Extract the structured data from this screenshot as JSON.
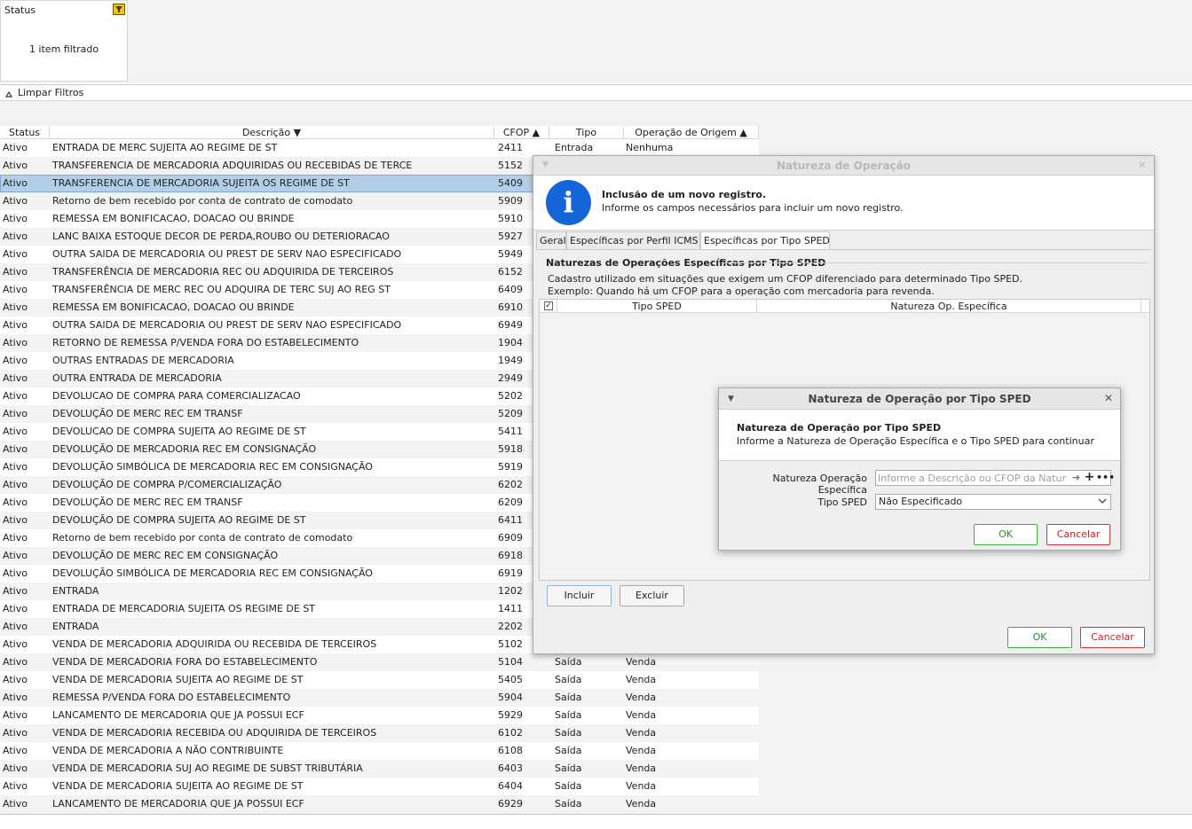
{
  "filter": {
    "card_title": "Status",
    "card_message": "1 item filtrado",
    "clear_label": "Limpar Filtros"
  },
  "grid": {
    "columns": {
      "status": "Status",
      "descricao": "Descrição ▼",
      "cfop": "CFOP ▲",
      "tipo": "Tipo",
      "origem": "Operação de Origem ▲"
    },
    "rows": [
      {
        "status": "Ativo",
        "desc": "ENTRADA DE MERC SUJEITA AO REGIME DE ST",
        "cfop": "2411",
        "tipo": "Entrada",
        "origem": "Nenhuma"
      },
      {
        "status": "Ativo",
        "desc": "TRANSFERENCIA DE MERCADORIA ADQUIRIDAS OU RECEBIDAS DE TERCE",
        "cfop": "5152",
        "tipo": "",
        "origem": ""
      },
      {
        "status": "Ativo",
        "desc": "TRANSFERENCIA DE MERCADORIA SUJEITA OS REGIME DE ST",
        "cfop": "5409",
        "tipo": "",
        "origem": ""
      },
      {
        "status": "Ativo",
        "desc": "Retorno de bem recebido por conta de contrato de comodato",
        "cfop": "5909",
        "tipo": "",
        "origem": ""
      },
      {
        "status": "Ativo",
        "desc": "REMESSA EM BONIFICACAO, DOACAO OU BRINDE",
        "cfop": "5910",
        "tipo": "",
        "origem": ""
      },
      {
        "status": "Ativo",
        "desc": "LANC BAIXA ESTOQUE DECOR DE PERDA,ROUBO OU DETERIORACAO",
        "cfop": "5927",
        "tipo": "",
        "origem": ""
      },
      {
        "status": "Ativo",
        "desc": "OUTRA SAIDA DE MERCADORIA OU PREST DE SERV NAO ESPECIFICADO",
        "cfop": "5949",
        "tipo": "",
        "origem": ""
      },
      {
        "status": "Ativo",
        "desc": "TRANSFERÊNCIA DE MERCADORIA REC OU ADQUIRIDA DE TERCEIROS",
        "cfop": "6152",
        "tipo": "",
        "origem": ""
      },
      {
        "status": "Ativo",
        "desc": "TRANSFERÊNCIA DE MERC REC OU ADQUIRA DE TERC SUJ AO REG ST",
        "cfop": "6409",
        "tipo": "",
        "origem": ""
      },
      {
        "status": "Ativo",
        "desc": "REMESSA EM BONIFICACAO, DOACAO OU BRINDE",
        "cfop": "6910",
        "tipo": "",
        "origem": ""
      },
      {
        "status": "Ativo",
        "desc": "OUTRA SAIDA DE MERCADORIA OU PREST DE SERV NAO ESPECIFICADO",
        "cfop": "6949",
        "tipo": "",
        "origem": ""
      },
      {
        "status": "Ativo",
        "desc": "RETORNO DE REMESSA P/VENDA FORA DO ESTABELECIMENTO",
        "cfop": "1904",
        "tipo": "",
        "origem": ""
      },
      {
        "status": "Ativo",
        "desc": "OUTRAS ENTRADAS DE MERCADORIA",
        "cfop": "1949",
        "tipo": "",
        "origem": ""
      },
      {
        "status": "Ativo",
        "desc": "OUTRA ENTRADA DE MERCADORIA",
        "cfop": "2949",
        "tipo": "",
        "origem": ""
      },
      {
        "status": "Ativo",
        "desc": "DEVOLUCAO DE COMPRA PARA COMERCIALIZACAO",
        "cfop": "5202",
        "tipo": "",
        "origem": ""
      },
      {
        "status": "Ativo",
        "desc": "DEVOLUÇÃO DE MERC REC EM TRANSF",
        "cfop": "5209",
        "tipo": "",
        "origem": ""
      },
      {
        "status": "Ativo",
        "desc": "DEVOLUCAO DE COMPRA SUJEITA AO REGIME DE ST",
        "cfop": "5411",
        "tipo": "",
        "origem": ""
      },
      {
        "status": "Ativo",
        "desc": "DEVOLUÇÃO DE MERCADORIA REC EM CONSIGNAÇÃO",
        "cfop": "5918",
        "tipo": "",
        "origem": ""
      },
      {
        "status": "Ativo",
        "desc": "DEVOLUÇÃO SIMBÓLICA DE MERCADORIA REC EM CONSIGNAÇÃO",
        "cfop": "5919",
        "tipo": "",
        "origem": ""
      },
      {
        "status": "Ativo",
        "desc": "DEVOLUÇÃO DE COMPRA P/COMERCIALIZAÇÃO",
        "cfop": "6202",
        "tipo": "",
        "origem": ""
      },
      {
        "status": "Ativo",
        "desc": "DEVOLUÇÃO DE MERC REC EM TRANSF",
        "cfop": "6209",
        "tipo": "",
        "origem": ""
      },
      {
        "status": "Ativo",
        "desc": "DEVOLUÇÃO DE COMPRA SUJEITA AO REGIME DE ST",
        "cfop": "6411",
        "tipo": "",
        "origem": ""
      },
      {
        "status": "Ativo",
        "desc": "Retorno de bem recebido por conta de contrato de comodato",
        "cfop": "6909",
        "tipo": "",
        "origem": ""
      },
      {
        "status": "Ativo",
        "desc": "DEVOLUÇÃO DE MERC REC EM CONSIGNAÇÃO",
        "cfop": "6918",
        "tipo": "",
        "origem": ""
      },
      {
        "status": "Ativo",
        "desc": "DEVOLUÇÃO SIMBÓLICA DE MERCADORIA REC EM CONSIGNAÇÃO",
        "cfop": "6919",
        "tipo": "",
        "origem": ""
      },
      {
        "status": "Ativo",
        "desc": "ENTRADA",
        "cfop": "1202",
        "tipo": "",
        "origem": ""
      },
      {
        "status": "Ativo",
        "desc": "ENTRADA DE MERCADORIA SUJEITA OS REGIME DE ST",
        "cfop": "1411",
        "tipo": "",
        "origem": ""
      },
      {
        "status": "Ativo",
        "desc": "ENTRADA",
        "cfop": "2202",
        "tipo": "",
        "origem": ""
      },
      {
        "status": "Ativo",
        "desc": "VENDA DE MERCADORIA ADQUIRIDA OU RECEBIDA DE TERCEIROS",
        "cfop": "5102",
        "tipo": "",
        "origem": ""
      },
      {
        "status": "Ativo",
        "desc": "VENDA DE MERCADORIA FORA DO ESTABELECIMENTO",
        "cfop": "5104",
        "tipo": "Saída",
        "origem": "Venda"
      },
      {
        "status": "Ativo",
        "desc": "VENDA DE MERCADORIA SUJEITA AO REGIME DE ST",
        "cfop": "5405",
        "tipo": "Saída",
        "origem": "Venda"
      },
      {
        "status": "Ativo",
        "desc": "REMESSA P/VENDA FORA DO ESTABELECIMENTO",
        "cfop": "5904",
        "tipo": "Saída",
        "origem": "Venda"
      },
      {
        "status": "Ativo",
        "desc": "LANCAMENTO DE MERCADORIA QUE JA POSSUI ECF",
        "cfop": "5929",
        "tipo": "Saída",
        "origem": "Venda"
      },
      {
        "status": "Ativo",
        "desc": "VENDA DE MERCADORIA RECEBIDA OU ADQUIRIDA DE TERCEIROS",
        "cfop": "6102",
        "tipo": "Saída",
        "origem": "Venda"
      },
      {
        "status": "Ativo",
        "desc": "VENDA DE MERCADORIA A NÃO CONTRIBUINTE",
        "cfop": "6108",
        "tipo": "Saída",
        "origem": "Venda"
      },
      {
        "status": "Ativo",
        "desc": "VENDA DE MERCADORIA SUJ AO REGIME DE SUBST TRIBUTÁRIA",
        "cfop": "6403",
        "tipo": "Saída",
        "origem": "Venda"
      },
      {
        "status": "Ativo",
        "desc": "VENDA DE MERCADORIA SUJEITA AO REGIME DE ST",
        "cfop": "6404",
        "tipo": "Saída",
        "origem": "Venda"
      },
      {
        "status": "Ativo",
        "desc": "LANCAMENTO DE MERCADORIA QUE JA POSSUI ECF",
        "cfop": "6929",
        "tipo": "Saída",
        "origem": "Venda"
      }
    ],
    "selected_index": 2
  },
  "dialog": {
    "title": "Natureza de Operação",
    "header_title": "Inclusão de um novo registro.",
    "header_subtitle": "Informe os campos necessários para incluir um novo registro.",
    "tabs": [
      "Geral",
      "Específicas por Perfil ICMS",
      "Específicas por Tipo SPED"
    ],
    "active_tab": 2,
    "section_title": "Naturezas de Operações Específicas por Tipo SPED",
    "section_desc1": "Cadastro utilizado em situações que exigem um CFOP diferenciado para determinado Tipo SPED.",
    "section_desc2": "Exemplo: Quando há um CFOP para a operação com mercadoria para revenda.",
    "table_columns": {
      "tipo": "Tipo SPED",
      "natureza": "Natureza Op. Específica"
    },
    "include_label": "Incluir",
    "delete_label": "Excluir",
    "ok_label": "OK",
    "cancel_label": "Cancelar"
  },
  "subdialog": {
    "title": "Natureza de Operação por Tipo SPED",
    "header_title": "Natureza de Operação por Tipo SPED",
    "header_subtitle": "Informe a Natureza de Operação Específica e o Tipo SPED para continuar",
    "natureza_label": "Natureza Operação Específica",
    "natureza_placeholder": "Informe a Descrição ou CFOP da Natureza",
    "natureza_value": "",
    "tipo_label": "Tipo SPED",
    "tipo_value": "Não Especificado",
    "ok_label": "OK",
    "cancel_label": "Cancelar"
  },
  "icons": {
    "filter": "filter-icon",
    "info": "info-icon",
    "arrow": "arrow-right-icon",
    "plus": "plus-icon",
    "more": "more-icon",
    "chevron": "chevron-down-icon",
    "close": "close-icon"
  }
}
